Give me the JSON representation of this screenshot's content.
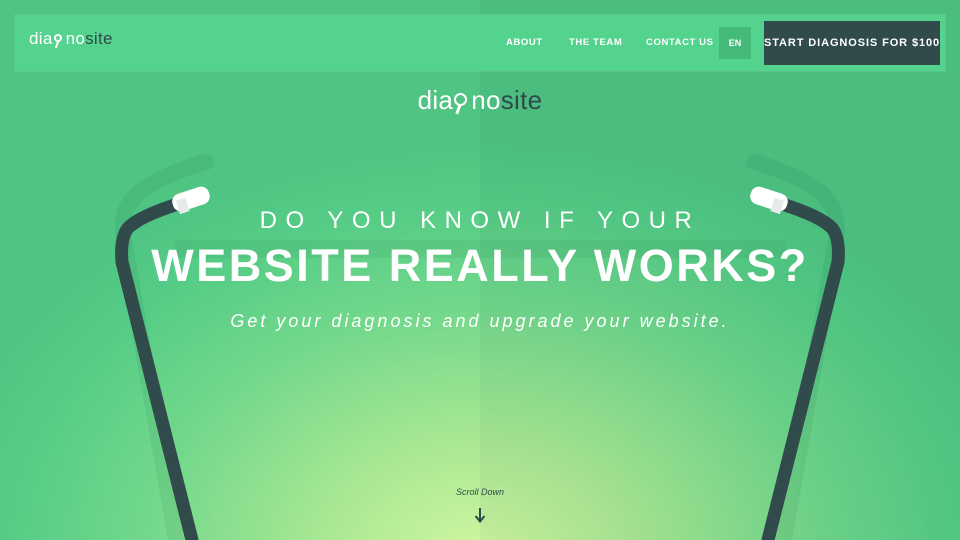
{
  "brand": {
    "logo_prefix": "dia",
    "logo_mid": "no",
    "logo_suffix": "site"
  },
  "nav": {
    "items": [
      {
        "label": "ABOUT"
      },
      {
        "label": "THE TEAM"
      },
      {
        "label": "CONTACT US"
      }
    ],
    "language": "EN",
    "cta": "START DIAGNOSIS FOR $100"
  },
  "hero": {
    "line1": "DO YOU KNOW IF YOUR",
    "line2": "WEBSITE REALLY WORKS?",
    "subtitle": "Get your diagnosis and upgrade your website."
  },
  "scroll": {
    "label": "Scroll Down",
    "icon": "arrow-down-icon"
  },
  "colors": {
    "background": "#55cc86",
    "nav_bg": "#53d38d",
    "dark": "#314b4c",
    "glow": "#d2f7a0"
  }
}
